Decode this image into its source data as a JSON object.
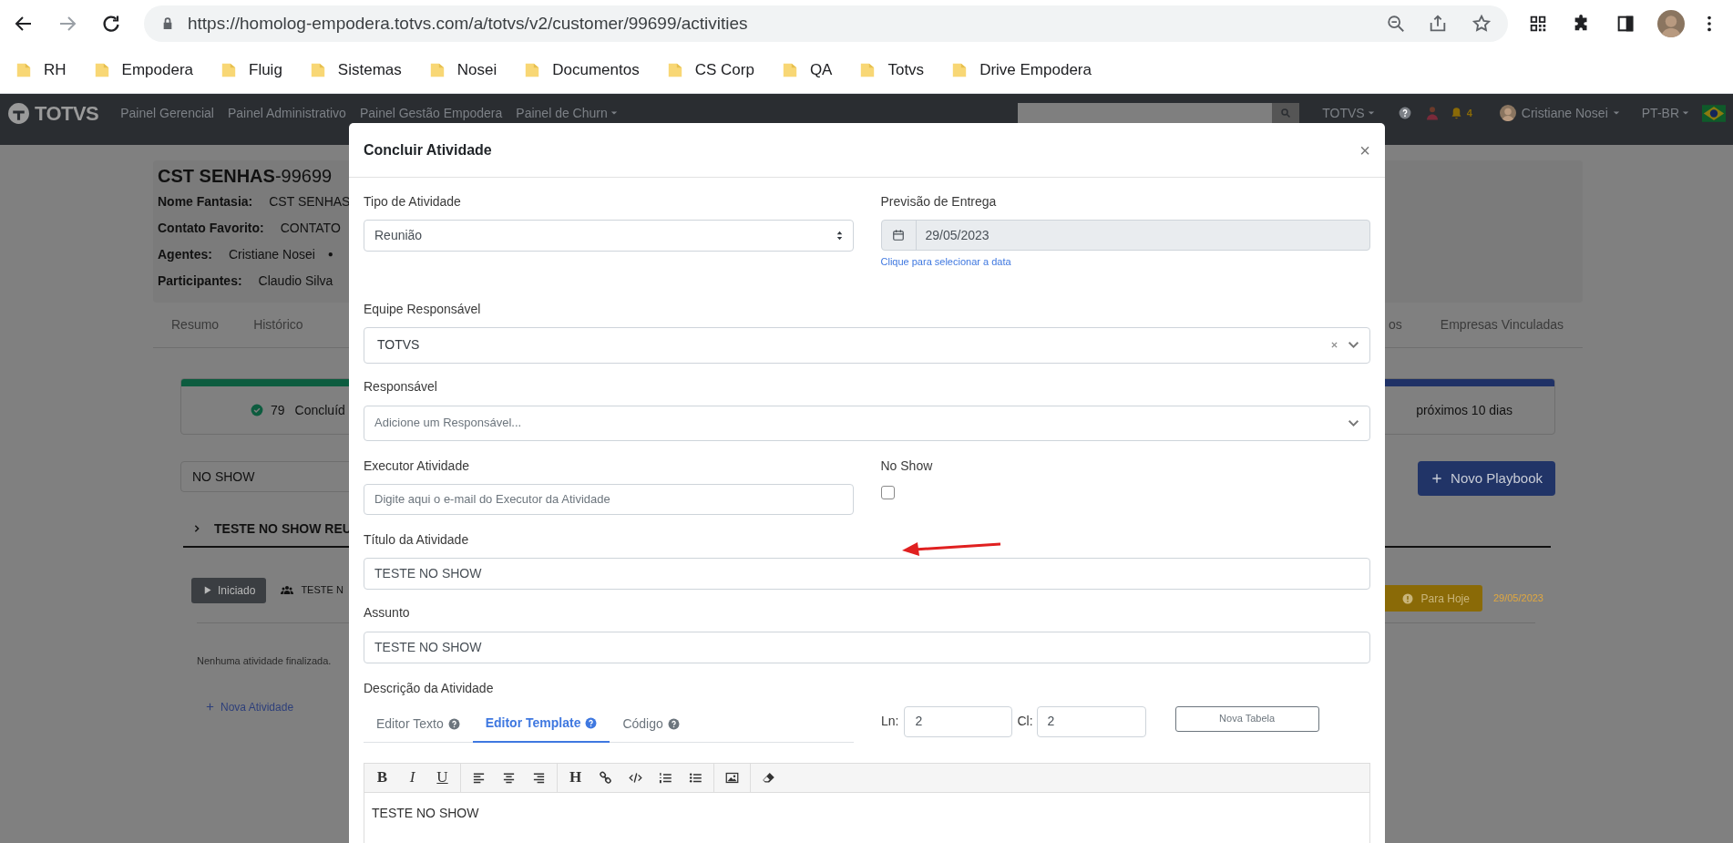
{
  "browser": {
    "url": "https://homolog-empodera.totvs.com/a/totvs/v2/customer/99699/activities",
    "bookmarks": [
      "RH",
      "Empodera",
      "Fluig",
      "Sistemas",
      "Nosei",
      "Documentos",
      "CS Corp",
      "QA",
      "Totvs",
      "Drive Empodera"
    ]
  },
  "navbar": {
    "brand": "TOTVS",
    "links": [
      "Painel Gerencial",
      "Painel Administrativo",
      "Painel Gestão Empodera",
      "Painel de Churn"
    ],
    "org_menu": "TOTVS",
    "notifications": "4",
    "user": "Cristiane Nosei",
    "language": "PT-BR"
  },
  "customer": {
    "name": "CST SENHAS",
    "code": "-99699",
    "fields": [
      {
        "label": "Nome Fantasia:",
        "value": "CST SENHAS"
      },
      {
        "label": "Contato Favorito:",
        "value": "CONTATO"
      },
      {
        "label": "Agentes:",
        "value": "Cristiane Nosei",
        "suffix": "●"
      },
      {
        "label": "Participantes:",
        "value": "Claudio Silva"
      }
    ]
  },
  "tabs": {
    "left": [
      "Resumo",
      "Histórico"
    ],
    "right": [
      "os",
      "Empresas Vinculadas"
    ]
  },
  "stat_cards": [
    {
      "count": "79",
      "label": "Concluíd",
      "color": "#0d5c3f"
    },
    {
      "label": "próximos 10 dias",
      "color": "#1f3166"
    }
  ],
  "filter": {
    "value": "NO SHOW"
  },
  "new_playbook": "Novo Playbook",
  "playbook": {
    "title": "TESTE NO SHOW REU",
    "status": "Iniciado",
    "team": "TESTE N",
    "due_badge": "Para Hoje",
    "due_date": "29/05/2023",
    "empty_text": "Nenhuma atividade finalizada.",
    "add_activity": "Nova Atividade"
  },
  "modal": {
    "title": "Concluir Atividade",
    "close": "×",
    "activity_type": {
      "label": "Tipo de Atividade",
      "value": "Reunião"
    },
    "delivery": {
      "label": "Previsão de Entrega",
      "value": "29/05/2023",
      "hint": "Clique para selecionar a data"
    },
    "team": {
      "label": "Equipe Responsável",
      "value": "TOTVS"
    },
    "owner": {
      "label": "Responsável",
      "placeholder": "Adicione um Responsável..."
    },
    "executor": {
      "label": "Executor Atividade",
      "placeholder": "Digite aqui o e-mail do Executor da Atividade"
    },
    "no_show": {
      "label": "No Show",
      "checked": false
    },
    "activity_title": {
      "label": "Título da Atividade",
      "value": "TESTE NO SHOW"
    },
    "subject": {
      "label": "Assunto",
      "value": "TESTE NO SHOW"
    },
    "description": {
      "label": "Descrição da Atividade",
      "tabs": [
        {
          "label": "Editor Texto",
          "selected": false
        },
        {
          "label": "Editor Template",
          "selected": true
        },
        {
          "label": "Código",
          "selected": false
        }
      ],
      "rows": {
        "label": "Ln:",
        "value": "2"
      },
      "cols": {
        "label": "Cl:",
        "value": "2"
      },
      "new_table": "Nova Tabela",
      "toolbar": [
        [
          {
            "kind": "bold",
            "label": "B"
          },
          {
            "kind": "italic",
            "label": "I"
          },
          {
            "kind": "underline",
            "label": "U"
          }
        ],
        [
          {
            "kind": "align-left"
          },
          {
            "kind": "align-center"
          },
          {
            "kind": "align-right"
          }
        ],
        [
          {
            "kind": "heading",
            "label": "H"
          },
          {
            "kind": "link"
          },
          {
            "kind": "code"
          },
          {
            "kind": "ordered-list"
          },
          {
            "kind": "bullet-list"
          }
        ],
        [
          {
            "kind": "image"
          }
        ],
        [
          {
            "kind": "eraser"
          }
        ]
      ],
      "content": "TESTE NO SHOW"
    }
  }
}
